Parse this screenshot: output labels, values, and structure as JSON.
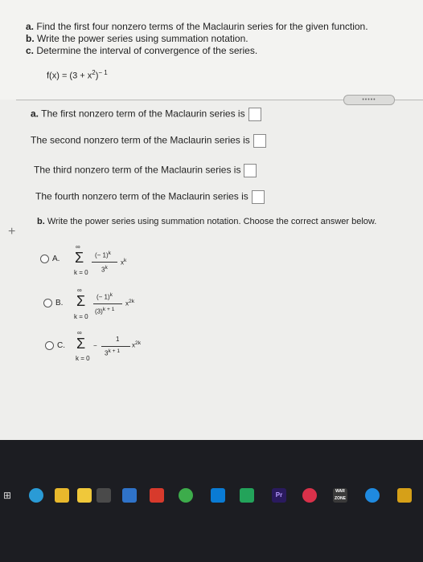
{
  "instructions": {
    "a_prefix": "a.",
    "a_text": "Find the first four nonzero terms of the Maclaurin series for the given function.",
    "b_prefix": "b.",
    "b_text": "Write the power series using summation notation.",
    "c_prefix": "c.",
    "c_text": "Determine the interval of convergence of the series."
  },
  "function": {
    "base": "f(x) = (3 + x",
    "sq": "2",
    "close": ")",
    "exp": "− 1"
  },
  "more_button": "•••••",
  "part_a": {
    "q1_prefix": "a.",
    "q1": "The first nonzero term of the Maclaurin series is",
    "q2": "The second nonzero term of the Maclaurin series is",
    "q3": "The third nonzero term of the Maclaurin series is",
    "q4": "The fourth nonzero term of the Maclaurin series is"
  },
  "part_b": {
    "prefix": "b.",
    "text": "Write the power series using summation notation. Choose the correct answer below."
  },
  "options": [
    {
      "label": "A.",
      "num": "(− 1)",
      "num_exp": "k",
      "den": "3",
      "den_exp": "k",
      "var": "x",
      "var_exp": "k",
      "lower": "k = 0",
      "upper": "∞"
    },
    {
      "label": "B.",
      "num": "(− 1)",
      "num_exp": "k",
      "den": "(3)",
      "den_exp": "k + 1",
      "var": "x",
      "var_exp": "2k",
      "lower": "k = 0",
      "upper": "∞"
    },
    {
      "label": "C.",
      "num": "1",
      "num_exp": "",
      "den": "3",
      "den_exp": "k + 1",
      "var": "x",
      "var_exp": "2k",
      "lower": "k = 0",
      "upper": "∞",
      "sign": "−"
    }
  ],
  "plus_icon": "+",
  "taskbar": {
    "items": [
      "edge-icon",
      "files-icon",
      "notes-icon",
      "calculator-icon",
      "mail-icon",
      "office-icon",
      "chrome-icon",
      "media-icon",
      "app-icon",
      "premiere-icon",
      "browser-icon",
      "warzone-icon",
      "settings-icon",
      "app-icon-2"
    ],
    "pr_label": "Pr",
    "war_label": "WAR ZONE"
  }
}
